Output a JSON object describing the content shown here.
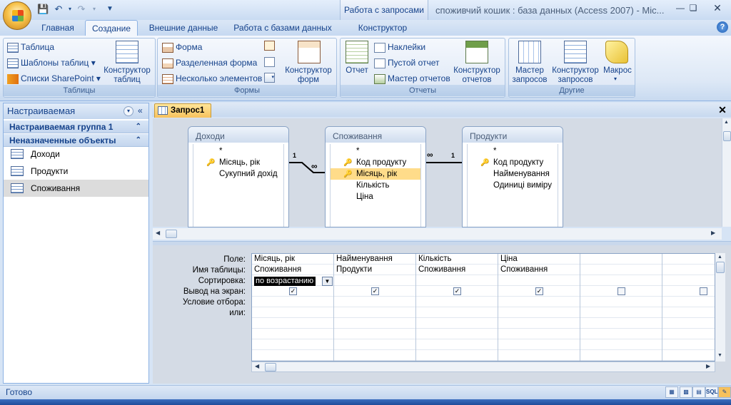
{
  "window": {
    "title": "споживчий кошик : база данных (Access 2007) - Mic...",
    "context_tab_title": "Работа с запросами"
  },
  "ribbon_tabs": [
    "Главная",
    "Создание",
    "Внешние данные",
    "Работа с базами данных",
    "Конструктор"
  ],
  "groups": {
    "tables": {
      "label": "Таблицы",
      "table": "Таблица",
      "templates": "Шаблоны таблиц",
      "sharepoint": "Списки SharePoint",
      "designer": "Конструктор таблиц"
    },
    "forms": {
      "label": "Формы",
      "form": "Форма",
      "split_form": "Разделенная форма",
      "multiple": "Несколько элементов",
      "designer": "Конструктор форм"
    },
    "reports": {
      "label": "Отчеты",
      "report": "Отчет",
      "labels": "Наклейки",
      "blank": "Пустой отчет",
      "wizard": "Мастер отчетов",
      "designer": "Конструктор отчетов"
    },
    "other": {
      "label": "Другие",
      "query_wizard": "Мастер запросов",
      "query_designer": "Конструктор запросов",
      "macro": "Макрос"
    }
  },
  "nav": {
    "header": "Настраиваемая",
    "groups": [
      "Настраиваемая группа 1",
      "Неназначенные объекты"
    ],
    "items": [
      "Доходи",
      "Продукти",
      "Споживання"
    ]
  },
  "document": {
    "tab": "Запрос1",
    "tables": [
      {
        "name": "Доходи",
        "fields": [
          "*",
          "Місяць, рік",
          "Сукупний дохід"
        ]
      },
      {
        "name": "Споживання",
        "fields": [
          "*",
          "Код продукту",
          "Місяць, рік",
          "Кількість",
          "Ціна"
        ]
      },
      {
        "name": "Продукти",
        "fields": [
          "*",
          "Код продукту",
          "Найменування",
          "Одиниці виміру"
        ]
      }
    ],
    "rel_one": "1",
    "rel_many": "∞"
  },
  "grid": {
    "row_labels": [
      "Поле:",
      "Имя таблицы:",
      "Сортировка:",
      "Вывод на экран:",
      "Условие отбора:",
      "или:"
    ],
    "columns": [
      {
        "field": "Місяць, рік",
        "table": "Споживання",
        "sort": "по возрастанию",
        "show": true
      },
      {
        "field": "Найменування",
        "table": "Продукти",
        "sort": "",
        "show": true
      },
      {
        "field": "Кількість",
        "table": "Споживання",
        "sort": "",
        "show": true
      },
      {
        "field": "Ціна",
        "table": "Споживання",
        "sort": "",
        "show": true
      },
      {
        "field": "",
        "table": "",
        "sort": "",
        "show": false
      },
      {
        "field": "",
        "table": "",
        "sort": "",
        "show": false
      }
    ]
  },
  "status": {
    "text": "Готово",
    "view_buttons": [
      "SQL"
    ]
  }
}
